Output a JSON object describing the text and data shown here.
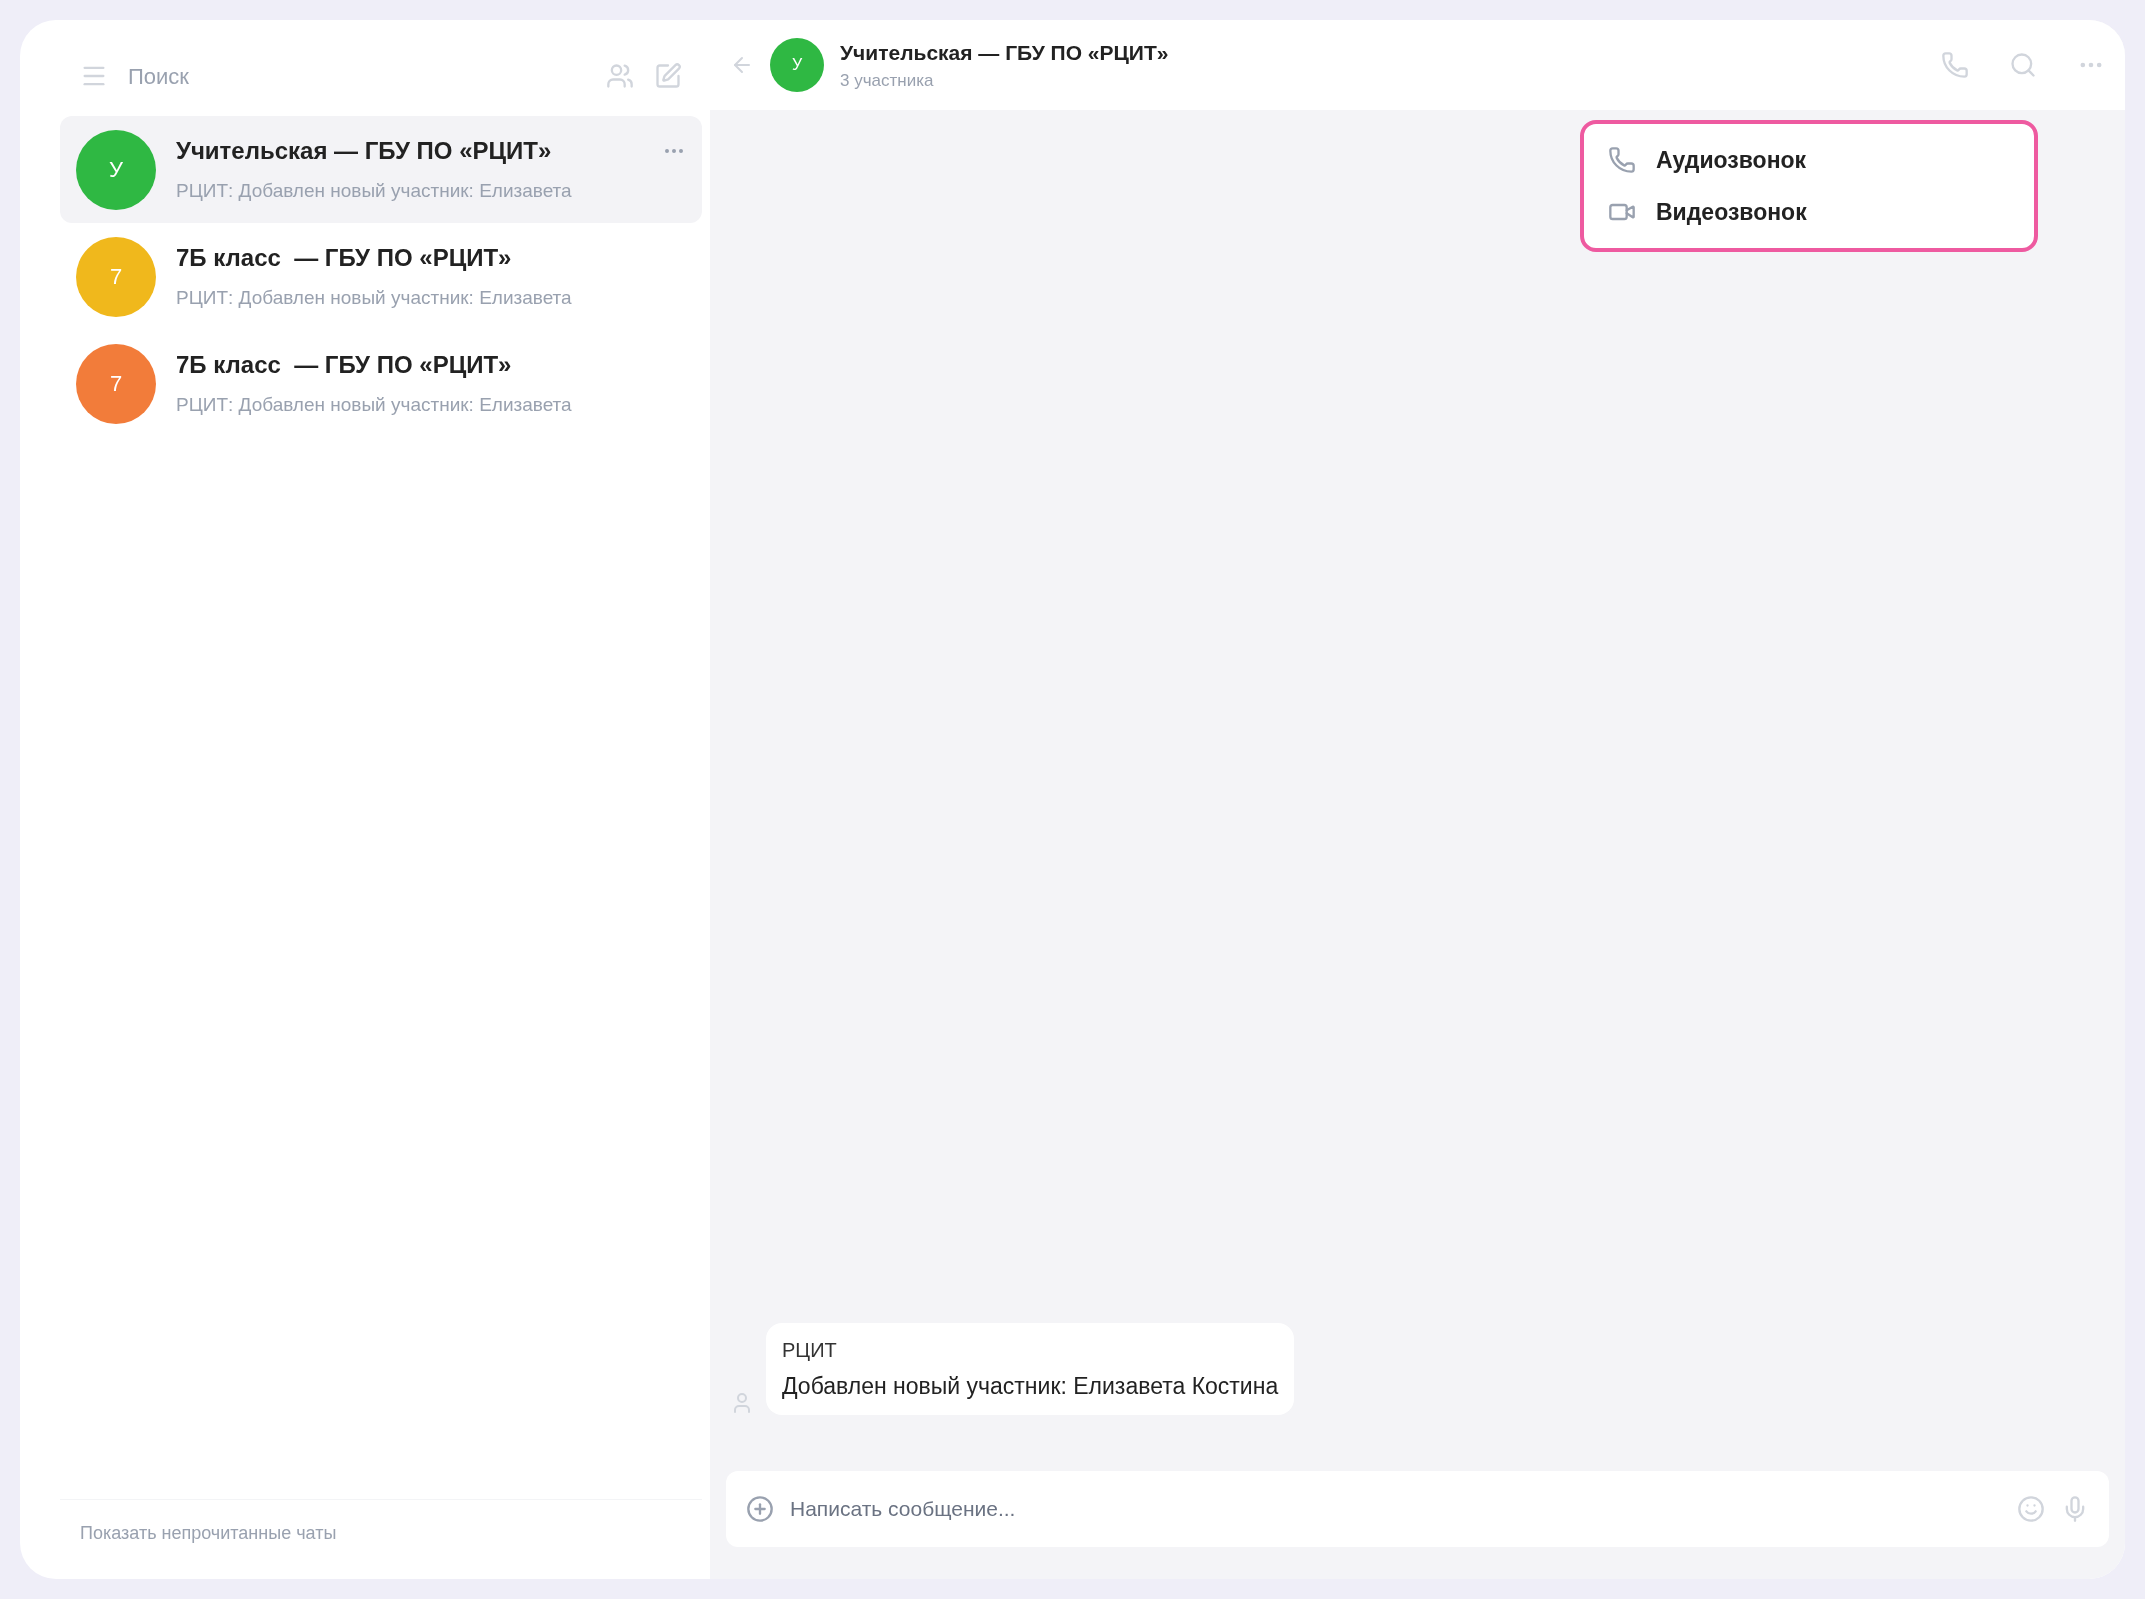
{
  "sidebar": {
    "search": {
      "placeholder": "Поиск"
    },
    "chats": [
      {
        "initial": "У",
        "color": "#2fb843",
        "title": "Учительская — ГБУ ПО «РЦИТ»",
        "preview": "РЦИТ: Добавлен новый участник: Елизавета",
        "selected": true
      },
      {
        "initial": "7",
        "color": "#f0b81c",
        "title": "7Б класс  — ГБУ ПО «РЦИТ»",
        "preview": "РЦИТ: Добавлен новый участник: Елизавета",
        "selected": false
      },
      {
        "initial": "7",
        "color": "#f27c3a",
        "title": "7Б класс  — ГБУ ПО «РЦИТ»",
        "preview": "РЦИТ: Добавлен новый участник: Елизавета",
        "selected": false
      }
    ],
    "footer": "Показать непрочитанные чаты"
  },
  "chat": {
    "title": "Учительская — ГБУ ПО «РЦИТ»",
    "subtitle": "3 участника",
    "initial": "У",
    "color": "#2fb843",
    "call_menu": [
      {
        "kind": "audio",
        "label": "Аудиозвонок"
      },
      {
        "kind": "video",
        "label": "Видеозвонок"
      }
    ],
    "message": {
      "author": "РЦИТ",
      "text": "Добавлен новый участник: Елизавета Костина"
    },
    "composer": {
      "placeholder": "Написать сообщение..."
    }
  }
}
